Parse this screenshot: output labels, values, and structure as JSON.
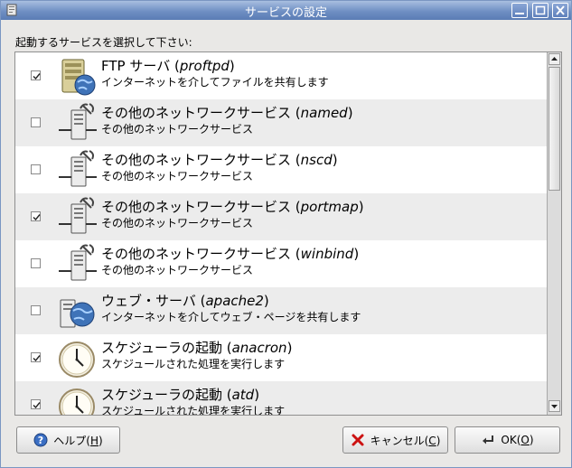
{
  "window": {
    "title": "サービスの設定"
  },
  "prompt": "起動するサービスを選択して下さい:",
  "services": [
    {
      "checked": true,
      "icon": "ftp-server-icon",
      "name": "FTP サーバ",
      "pkg": "proftpd",
      "desc": "インターネットを介してファイルを共有します"
    },
    {
      "checked": false,
      "icon": "network-server-icon",
      "name": "その他のネットワークサービス",
      "pkg": "named",
      "desc": "その他のネットワークサービス"
    },
    {
      "checked": false,
      "icon": "network-server-icon",
      "name": "その他のネットワークサービス",
      "pkg": "nscd",
      "desc": "その他のネットワークサービス"
    },
    {
      "checked": true,
      "icon": "network-server-icon",
      "name": "その他のネットワークサービス",
      "pkg": "portmap",
      "desc": "その他のネットワークサービス"
    },
    {
      "checked": false,
      "icon": "network-server-icon",
      "name": "その他のネットワークサービス",
      "pkg": "winbind",
      "desc": "その他のネットワークサービス"
    },
    {
      "checked": false,
      "icon": "web-server-icon",
      "name": "ウェブ・サーバ",
      "pkg": "apache2",
      "desc": "インターネットを介してウェブ・ページを共有します"
    },
    {
      "checked": true,
      "icon": "clock-icon",
      "name": "スケジューラの起動",
      "pkg": "anacron",
      "desc": "スケジュールされた処理を実行します"
    },
    {
      "checked": true,
      "icon": "clock-icon",
      "name": "スケジューラの起動",
      "pkg": "atd",
      "desc": "スケジュールされた処理を実行します"
    }
  ],
  "buttons": {
    "help": {
      "label": "ヘルプ(",
      "mnemonic": "H",
      "suffix": ")"
    },
    "cancel": {
      "label": "キャンセル(",
      "mnemonic": "C",
      "suffix": ")"
    },
    "ok": {
      "label": "OK(",
      "mnemonic": "O",
      "suffix": ")"
    }
  },
  "colors": {
    "titlebar": "#6f8fc3",
    "row_alt": "#ececec"
  }
}
